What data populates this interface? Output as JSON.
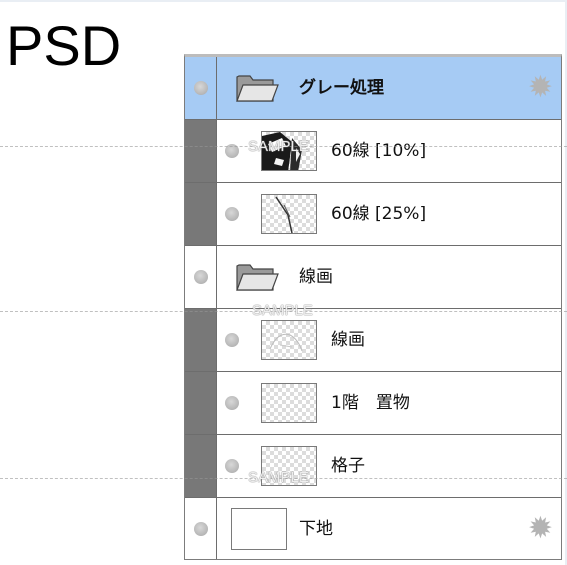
{
  "title": "PSD",
  "layers": [
    {
      "name": "グレー処理",
      "type": "folder",
      "selected": true,
      "settings_icon": "gear-icon"
    },
    {
      "name": "60線 [10%]",
      "type": "layer",
      "thumbnail": "tone-10-thumbnail"
    },
    {
      "name": "60線 [25%]",
      "type": "layer",
      "thumbnail": "tone-25-thumbnail"
    },
    {
      "name": "線画",
      "type": "folder"
    },
    {
      "name": "線画",
      "type": "layer",
      "thumbnail": "lineart-thumbnail"
    },
    {
      "name": "1階　置物",
      "type": "layer",
      "thumbnail": "transparent-thumbnail"
    },
    {
      "name": "格子",
      "type": "layer",
      "thumbnail": "transparent-thumbnail"
    },
    {
      "name": "下地",
      "type": "layer",
      "thumbnail": "white-thumbnail",
      "settings_icon": "gear-icon"
    }
  ],
  "watermark": "SAMPLE",
  "colors": {
    "selected_row": "#a6cbf4",
    "group_bar": "#787878"
  }
}
